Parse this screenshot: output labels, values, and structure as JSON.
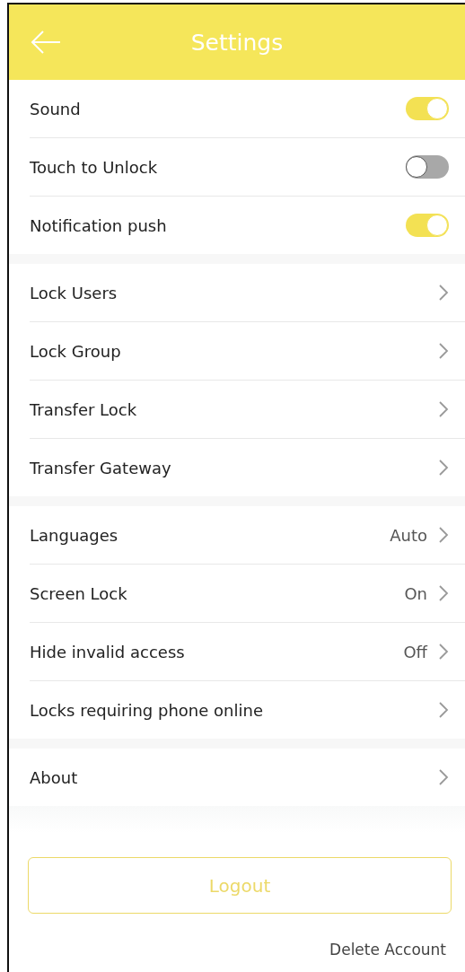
{
  "header": {
    "title": "Settings"
  },
  "sections": [
    {
      "items": [
        {
          "kind": "toggle",
          "label": "Sound",
          "on": true
        },
        {
          "kind": "toggle",
          "label": "Touch to Unlock",
          "on": false
        },
        {
          "kind": "toggle",
          "label": "Notification push",
          "on": true
        }
      ]
    },
    {
      "items": [
        {
          "kind": "link",
          "label": "Lock Users"
        },
        {
          "kind": "link",
          "label": "Lock Group"
        },
        {
          "kind": "link",
          "label": "Transfer Lock"
        },
        {
          "kind": "link",
          "label": "Transfer Gateway"
        }
      ]
    },
    {
      "items": [
        {
          "kind": "link",
          "label": "Languages",
          "value": "Auto"
        },
        {
          "kind": "link",
          "label": "Screen Lock",
          "value": "On"
        },
        {
          "kind": "link",
          "label": "Hide invalid access",
          "value": "Off"
        },
        {
          "kind": "link",
          "label": "Locks requiring phone online"
        }
      ]
    },
    {
      "items": [
        {
          "kind": "link",
          "label": "About"
        }
      ]
    }
  ],
  "logout_button": "Logout",
  "delete_account_link": "Delete Account"
}
